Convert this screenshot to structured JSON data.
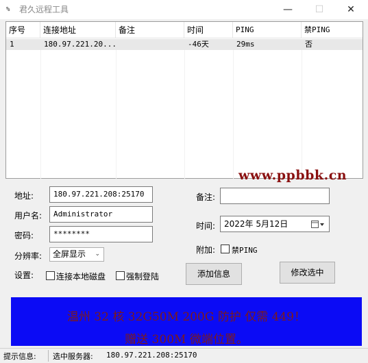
{
  "window": {
    "title": "君久远程工具",
    "icon_text": "%",
    "minimize_glyph": "—",
    "maximize_glyph": "☐",
    "close_glyph": "✕"
  },
  "list": {
    "columns": [
      "序号",
      "连接地址",
      "备注",
      "时间",
      "PING",
      "禁PING"
    ],
    "rows": [
      [
        "1",
        "180.97.221.20...",
        "",
        "-46天",
        "29ms",
        "否"
      ]
    ]
  },
  "watermark": "www.ppbbk.cn",
  "form": {
    "address_label": "地址:",
    "address_value": "180.97.221.208:25170",
    "username_label": "用户名:",
    "username_value": "Administrator",
    "password_label": "密码:",
    "password_value": "********",
    "resolution_label": "分辨率:",
    "resolution_value": "全屏显示",
    "settings_label": "设置:",
    "connect_disk_label": "连接本地磁盘",
    "force_login_label": "强制登陆",
    "remark_label": "备注:",
    "remark_value": "",
    "time_label": "时间:",
    "time_value": "2022年 5月12日",
    "attach_label": "附加:",
    "no_ping_label": "禁PING",
    "add_button": "添加信息",
    "edit_button": "修改选中"
  },
  "banner": {
    "line1": "温州 32 核 32G50M 200G 防护 仅需 449！",
    "line2": "赠送 300M 微端位置。"
  },
  "status": {
    "hint_label": "提示信息:",
    "hint_value": "",
    "selected_label": "选中服务器:",
    "selected_value": "180.97.221.208:25170"
  }
}
